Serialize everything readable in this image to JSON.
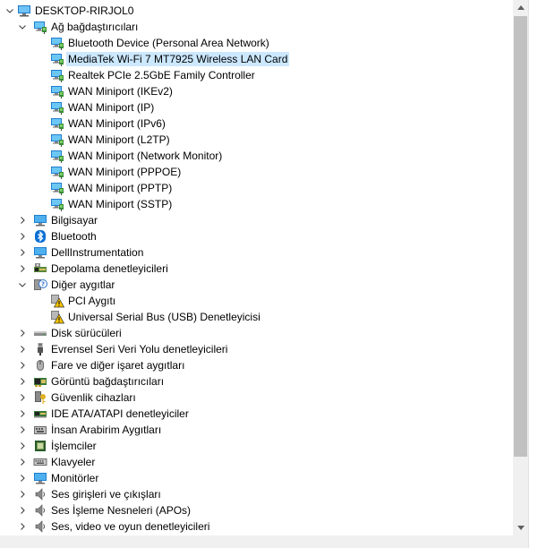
{
  "tree": {
    "root": {
      "label": "DESKTOP-RIRJOL0",
      "icon": "computer-icon"
    },
    "categories": [
      {
        "label": "Ağ bağdaştırıcıları",
        "icon": "network-adapter-icon",
        "expanded": true,
        "children": [
          {
            "label": "Bluetooth Device (Personal Area Network)",
            "icon": "network-adapter-icon"
          },
          {
            "label": "MediaTek Wi-Fi 7 MT7925 Wireless LAN Card",
            "icon": "network-adapter-icon",
            "selected": true
          },
          {
            "label": "Realtek PCIe 2.5GbE Family Controller",
            "icon": "network-adapter-icon"
          },
          {
            "label": "WAN Miniport (IKEv2)",
            "icon": "network-adapter-icon"
          },
          {
            "label": "WAN Miniport (IP)",
            "icon": "network-adapter-icon"
          },
          {
            "label": "WAN Miniport (IPv6)",
            "icon": "network-adapter-icon"
          },
          {
            "label": "WAN Miniport (L2TP)",
            "icon": "network-adapter-icon"
          },
          {
            "label": "WAN Miniport (Network Monitor)",
            "icon": "network-adapter-icon"
          },
          {
            "label": "WAN Miniport (PPPOE)",
            "icon": "network-adapter-icon"
          },
          {
            "label": "WAN Miniport (PPTP)",
            "icon": "network-adapter-icon"
          },
          {
            "label": "WAN Miniport (SSTP)",
            "icon": "network-adapter-icon"
          }
        ]
      },
      {
        "label": "Bilgisayar",
        "icon": "monitor-icon",
        "expanded": false
      },
      {
        "label": "Bluetooth",
        "icon": "bluetooth-icon",
        "expanded": false
      },
      {
        "label": "DellInstrumentation",
        "icon": "monitor-icon",
        "expanded": false
      },
      {
        "label": "Depolama denetleyicileri",
        "icon": "storage-controller-icon",
        "expanded": false
      },
      {
        "label": "Diğer aygıtlar",
        "icon": "unknown-device-icon",
        "expanded": true,
        "children": [
          {
            "label": "PCI Aygıtı",
            "icon": "warning-device-icon"
          },
          {
            "label": "Universal Serial Bus (USB) Denetleyicisi",
            "icon": "warning-device-icon"
          }
        ]
      },
      {
        "label": "Disk sürücüleri",
        "icon": "disk-drive-icon",
        "expanded": false
      },
      {
        "label": "Evrensel Seri Veri Yolu denetleyicileri",
        "icon": "usb-icon",
        "expanded": false
      },
      {
        "label": "Fare ve diğer işaret aygıtları",
        "icon": "mouse-icon",
        "expanded": false
      },
      {
        "label": "Görüntü bağdaştırıcıları",
        "icon": "display-adapter-icon",
        "expanded": false
      },
      {
        "label": "Güvenlik cihazları",
        "icon": "security-key-icon",
        "expanded": false
      },
      {
        "label": "IDE ATA/ATAPI denetleyiciler",
        "icon": "ide-controller-icon",
        "expanded": false
      },
      {
        "label": "İnsan Arabirim Aygıtları",
        "icon": "hid-icon",
        "expanded": false
      },
      {
        "label": "İşlemciler",
        "icon": "processor-icon",
        "expanded": false
      },
      {
        "label": "Klavyeler",
        "icon": "keyboard-icon",
        "expanded": false
      },
      {
        "label": "Monitörler",
        "icon": "monitor-icon",
        "expanded": false
      },
      {
        "label": "Ses girişleri ve çıkışları",
        "icon": "speaker-icon",
        "expanded": false
      },
      {
        "label": "Ses İşleme Nesneleri (APOs)",
        "icon": "speaker-icon",
        "expanded": false
      },
      {
        "label": "Ses, video ve oyun denetleyicileri",
        "icon": "speaker-icon",
        "expanded": false
      }
    ]
  },
  "colors": {
    "selection": "#cce8ff",
    "scrollbar_track": "#f0f0f0",
    "scrollbar_thumb": "#c1c1c1"
  }
}
